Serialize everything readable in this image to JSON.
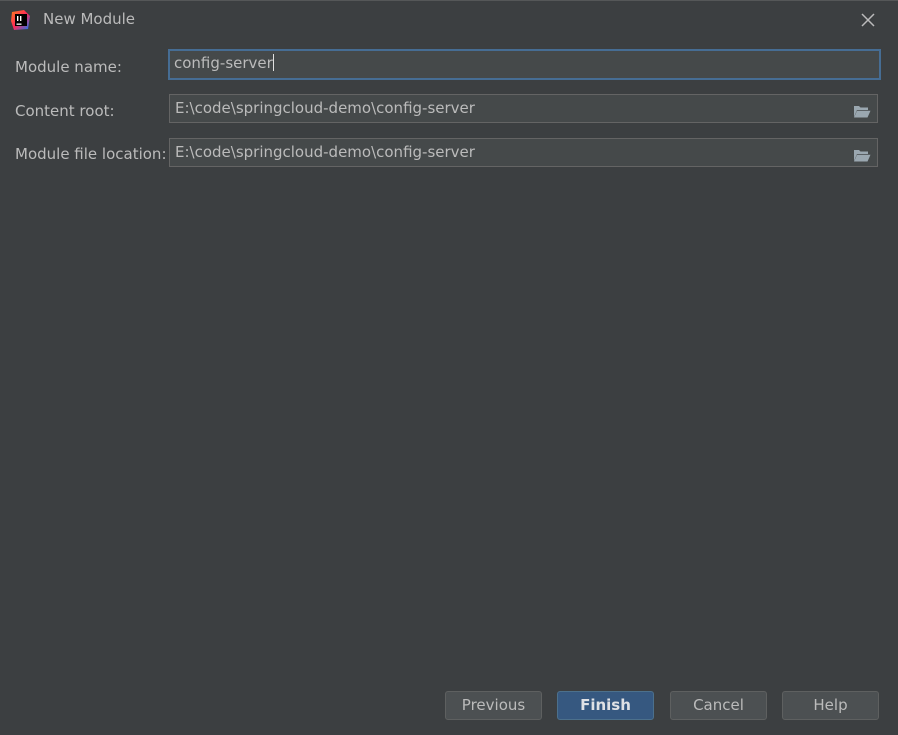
{
  "window": {
    "title": "New Module",
    "app_icon": "intellij-idea-icon",
    "close_icon": "close-icon"
  },
  "form": {
    "module_name": {
      "label": "Module name:",
      "value": "config-server"
    },
    "content_root": {
      "label": "Content root:",
      "value": "E:\\code\\springcloud-demo\\config-server",
      "browse_icon": "folder-open-icon"
    },
    "module_file_location": {
      "label": "Module file location:",
      "value": "E:\\code\\springcloud-demo\\config-server",
      "browse_icon": "folder-open-icon"
    }
  },
  "buttons": {
    "previous": "Previous",
    "finish": "Finish",
    "cancel": "Cancel",
    "help": "Help"
  },
  "colors": {
    "background": "#3c3f41",
    "field_background": "#45494a",
    "focus_border": "#466d94",
    "default_button": "#365880"
  }
}
